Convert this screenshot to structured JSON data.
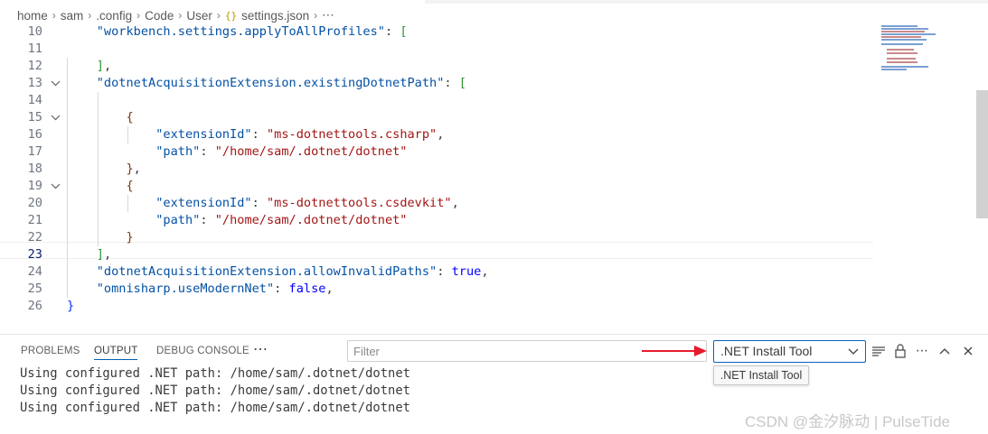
{
  "breadcrumb": {
    "items": [
      "home",
      "sam",
      ".config",
      "Code",
      "User"
    ],
    "file_icon": "{}",
    "file": "settings.json",
    "more": "⋯"
  },
  "editor": {
    "lines": [
      {
        "num": "10",
        "fold": "",
        "tokens": [
          {
            "t": "    ",
            "c": "p"
          },
          {
            "t": "\"workbench.settings.applyToAllProfiles\"",
            "c": "k"
          },
          {
            "t": ": ",
            "c": "p"
          },
          {
            "t": "[",
            "c": "br2"
          }
        ]
      },
      {
        "num": "11",
        "fold": "",
        "tokens": []
      },
      {
        "num": "12",
        "fold": "",
        "tokens": [
          {
            "t": "    ",
            "c": "p"
          },
          {
            "t": "]",
            "c": "br2"
          },
          {
            "t": ",",
            "c": "p"
          }
        ]
      },
      {
        "num": "13",
        "fold": "v",
        "tokens": [
          {
            "t": "    ",
            "c": "p"
          },
          {
            "t": "\"dotnetAcquisitionExtension.existingDotnetPath\"",
            "c": "k"
          },
          {
            "t": ": ",
            "c": "p"
          },
          {
            "t": "[",
            "c": "br2"
          }
        ]
      },
      {
        "num": "14",
        "fold": "",
        "tokens": []
      },
      {
        "num": "15",
        "fold": "v",
        "tokens": [
          {
            "t": "        ",
            "c": "p"
          },
          {
            "t": "{",
            "c": "br3"
          }
        ]
      },
      {
        "num": "16",
        "fold": "",
        "tokens": [
          {
            "t": "            ",
            "c": "p"
          },
          {
            "t": "\"extensionId\"",
            "c": "k"
          },
          {
            "t": ": ",
            "c": "p"
          },
          {
            "t": "\"ms-dotnettools.csharp\"",
            "c": "s"
          },
          {
            "t": ",",
            "c": "p"
          }
        ]
      },
      {
        "num": "17",
        "fold": "",
        "tokens": [
          {
            "t": "            ",
            "c": "p"
          },
          {
            "t": "\"path\"",
            "c": "k"
          },
          {
            "t": ": ",
            "c": "p"
          },
          {
            "t": "\"/home/sam/.dotnet/dotnet\"",
            "c": "s"
          }
        ]
      },
      {
        "num": "18",
        "fold": "",
        "tokens": [
          {
            "t": "        ",
            "c": "p"
          },
          {
            "t": "}",
            "c": "br3"
          },
          {
            "t": ",",
            "c": "p"
          }
        ]
      },
      {
        "num": "19",
        "fold": "v",
        "tokens": [
          {
            "t": "        ",
            "c": "p"
          },
          {
            "t": "{",
            "c": "br3"
          }
        ]
      },
      {
        "num": "20",
        "fold": "",
        "tokens": [
          {
            "t": "            ",
            "c": "p"
          },
          {
            "t": "\"extensionId\"",
            "c": "k"
          },
          {
            "t": ": ",
            "c": "p"
          },
          {
            "t": "\"ms-dotnettools.csdevkit\"",
            "c": "s"
          },
          {
            "t": ",",
            "c": "p"
          }
        ]
      },
      {
        "num": "21",
        "fold": "",
        "tokens": [
          {
            "t": "            ",
            "c": "p"
          },
          {
            "t": "\"path\"",
            "c": "k"
          },
          {
            "t": ": ",
            "c": "p"
          },
          {
            "t": "\"/home/sam/.dotnet/dotnet\"",
            "c": "s"
          }
        ]
      },
      {
        "num": "22",
        "fold": "",
        "tokens": [
          {
            "t": "        ",
            "c": "p"
          },
          {
            "t": "}",
            "c": "br3"
          }
        ]
      },
      {
        "num": "23",
        "fold": "",
        "current": true,
        "tokens": [
          {
            "t": "    ",
            "c": "p"
          },
          {
            "t": "]",
            "c": "br2"
          },
          {
            "t": ",",
            "c": "p"
          }
        ]
      },
      {
        "num": "24",
        "fold": "",
        "tokens": [
          {
            "t": "    ",
            "c": "p"
          },
          {
            "t": "\"dotnetAcquisitionExtension.allowInvalidPaths\"",
            "c": "k"
          },
          {
            "t": ": ",
            "c": "p"
          },
          {
            "t": "true",
            "c": "b"
          },
          {
            "t": ",",
            "c": "p"
          }
        ]
      },
      {
        "num": "25",
        "fold": "",
        "tokens": [
          {
            "t": "    ",
            "c": "p"
          },
          {
            "t": "\"omnisharp.useModernNet\"",
            "c": "k"
          },
          {
            "t": ": ",
            "c": "p"
          },
          {
            "t": "false",
            "c": "b"
          },
          {
            "t": ",",
            "c": "p"
          }
        ]
      },
      {
        "num": "26",
        "fold": "",
        "tokens": [
          {
            "t": "}",
            "c": "br1"
          }
        ]
      }
    ]
  },
  "panel": {
    "tabs": [
      "PROBLEMS",
      "OUTPUT",
      "DEBUG CONSOLE"
    ],
    "active_tab": "OUTPUT",
    "more": "⋯",
    "filter_placeholder": "Filter",
    "channel_selected": ".NET Install Tool",
    "channel_tooltip": ".NET Install Tool",
    "icons": [
      "word-wrap-icon",
      "lock-icon",
      "more-actions-icon",
      "maximize-icon",
      "close-icon"
    ],
    "output_lines": [
      "Using configured .NET path: /home/sam/.dotnet/dotnet",
      "Using configured .NET path: /home/sam/.dotnet/dotnet",
      "Using configured .NET path: /home/sam/.dotnet/dotnet"
    ]
  },
  "watermark": "CSDN @金汐脉动 | PulseTide",
  "colors": {
    "key": "#0451a5",
    "string": "#a31515",
    "boolean": "#0000ff",
    "accent": "#005fb8",
    "arrow": "#e8192c"
  }
}
